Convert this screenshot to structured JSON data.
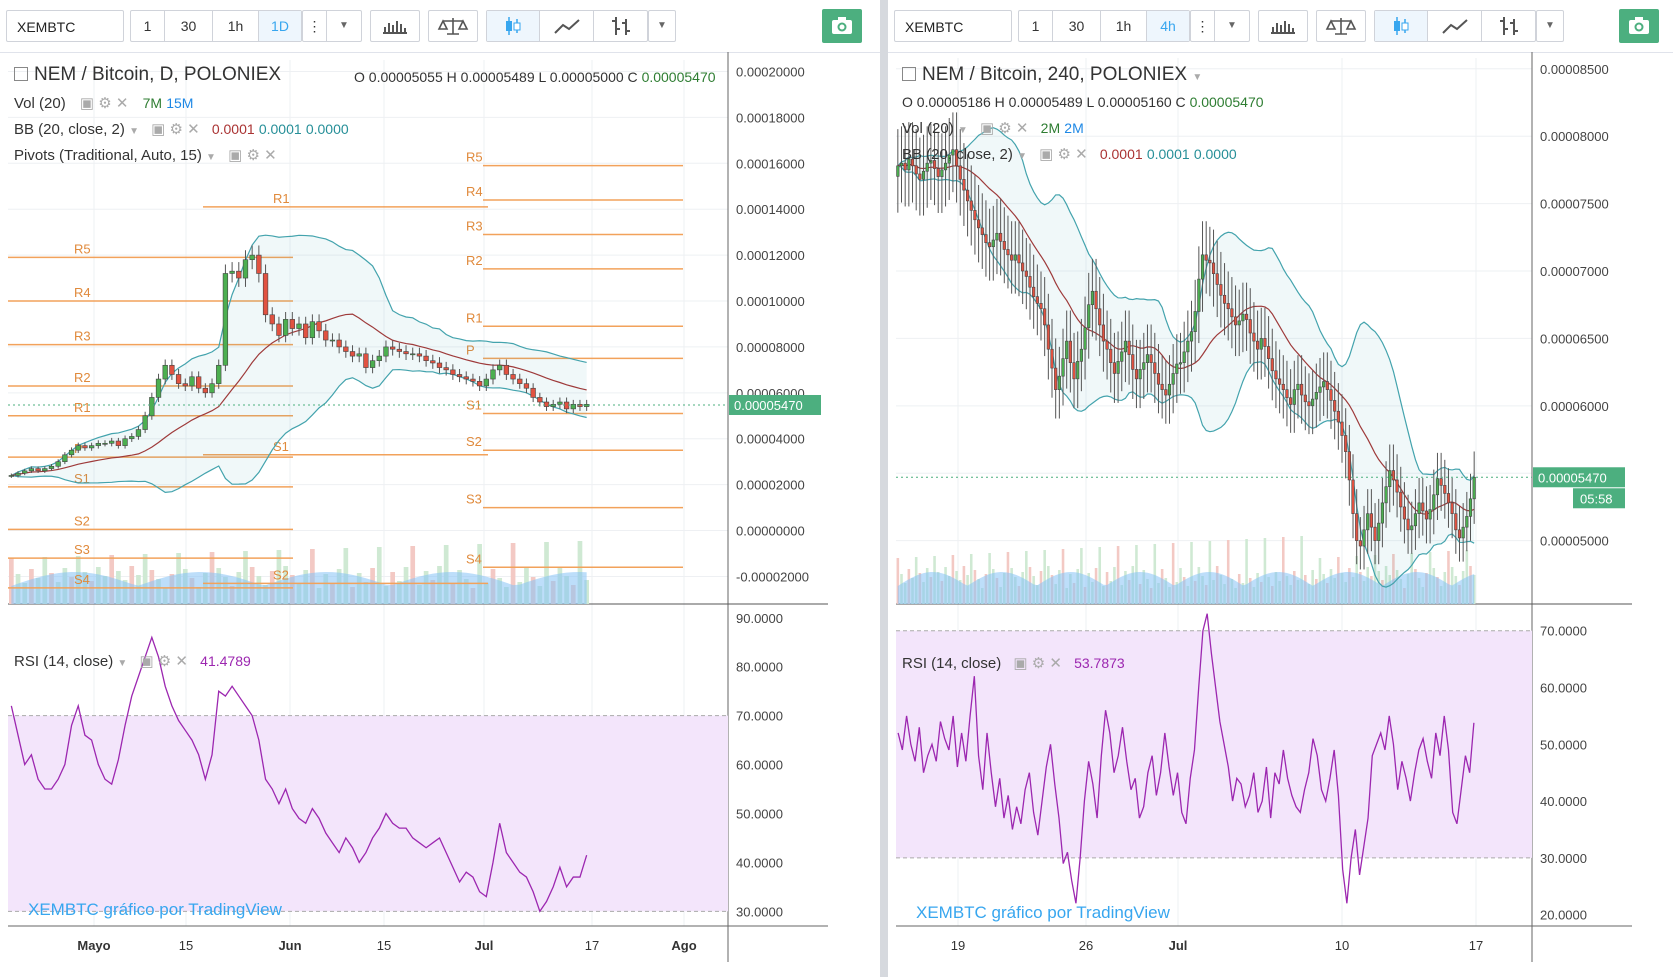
{
  "left": {
    "symbol": "XEMBTC",
    "intervals": [
      "1",
      "30",
      "1h",
      "1D"
    ],
    "active_interval": "1D",
    "title": "NEM / Bitcoin, D, POLONIEX",
    "ohlc": {
      "o_label": "O",
      "o": "0.00005055",
      "h_label": "H",
      "h": "0.00005489",
      "l_label": "L",
      "l": "0.00005000",
      "c_label": "C",
      "c": "0.00005470"
    },
    "vol": {
      "label": "Vol (20)",
      "v1": "7M",
      "v2": "15M"
    },
    "bb": {
      "label": "BB (20, close, 2)",
      "v1": "0.0001",
      "v2": "0.0001",
      "v3": "0.0000"
    },
    "pivots": {
      "label": "Pivots (Traditional, Auto, 15)"
    },
    "rsi": {
      "label": "RSI (14, close)",
      "value": "41.4789"
    },
    "watermark": "XEMBTC gráfico por TradingView",
    "price_tag": "0.00005470",
    "colors": {
      "up": "#4caf50",
      "down": "#e15241",
      "bb": "#43a3ad",
      "basis": "#9e3a3a",
      "pivot": "#f2a25b",
      "rsi": "#9c27b0",
      "rsi_band": "#f3e5fb",
      "tag": "#4caf7f"
    }
  },
  "right": {
    "symbol": "XEMBTC",
    "intervals": [
      "1",
      "30",
      "1h",
      "4h"
    ],
    "active_interval": "4h",
    "title": "NEM / Bitcoin, 240, POLONIEX",
    "ohlc": {
      "o_label": "O",
      "o": "0.00005186",
      "h_label": "H",
      "h": "0.00005489",
      "l_label": "L",
      "l": "0.00005160",
      "c_label": "C",
      "c": "0.00005470"
    },
    "vol": {
      "label": "Vol (20)",
      "v1": "2M",
      "v2": "2M"
    },
    "bb": {
      "label": "BB (20, close, 2)",
      "v1": "0.0001",
      "v2": "0.0001",
      "v3": "0.0000"
    },
    "rsi": {
      "label": "RSI (14, close)",
      "value": "53.7873"
    },
    "watermark": "XEMBTC gráfico por TradingView",
    "price_tag": "0.00005470",
    "countdown": "05:58"
  },
  "chart_data": [
    {
      "type": "candlestick",
      "panel": "left",
      "title": "NEM / Bitcoin, D, POLONIEX",
      "price_axis": [
        "0.00020000",
        "0.00018000",
        "0.00016000",
        "0.00014000",
        "0.00012000",
        "0.00010000",
        "0.00008000",
        "0.00006000",
        "0.00004000",
        "0.00002000",
        "0.00000000",
        "-0.00002000"
      ],
      "ylim": [
        -3.2e-05,
        0.000205
      ],
      "time_axis": [
        "Mayo",
        "15",
        "Jun",
        "15",
        "Jul",
        "17",
        "Ago"
      ],
      "time_axis_bold": [
        "Mayo",
        "Jun",
        "Jul",
        "Ago"
      ],
      "close": [
        2.4e-05,
        2.5e-05,
        2.6e-05,
        2.7e-05,
        2.6e-05,
        2.7e-05,
        2.8e-05,
        3e-05,
        3.3e-05,
        3.5e-05,
        3.7e-05,
        3.6e-05,
        3.7e-05,
        3.8e-05,
        3.8e-05,
        3.9e-05,
        3.7e-05,
        4e-05,
        4.1e-05,
        4.4e-05,
        5e-05,
        5.8e-05,
        6.6e-05,
        7.2e-05,
        6.8e-05,
        6.4e-05,
        6.3e-05,
        6.7e-05,
        6.2e-05,
        6e-05,
        6.4e-05,
        7.2e-05,
        0.000112,
        0.000113,
        0.00011,
        0.000118,
        0.00012,
        0.000112,
        9.4e-05,
        9e-05,
        8.5e-05,
        9.2e-05,
        8.8e-05,
        9e-05,
        8.4e-05,
        9.1e-05,
        8.7e-05,
        8.3e-05,
        8.3e-05,
        8e-05,
        7.8e-05,
        7.6e-05,
        7.7e-05,
        7.1e-05,
        7.4e-05,
        7.6e-05,
        8e-05,
        7.9e-05,
        7.8e-05,
        7.7e-05,
        7.7e-05,
        7.6e-05,
        7.4e-05,
        7.3e-05,
        7.1e-05,
        7e-05,
        6.8e-05,
        6.7e-05,
        6.6e-05,
        6.5e-05,
        6.3e-05,
        6.6e-05,
        7e-05,
        7.2e-05,
        6.8e-05,
        6.6e-05,
        6.4e-05,
        6.2e-05,
        5.8e-05,
        5.6e-05,
        5.4e-05,
        5.5e-05,
        5.6e-05,
        5.3e-05,
        5.5e-05,
        5.4e-05,
        5.5e-05
      ],
      "pivot_levels": [
        {
          "label": "R5",
          "value": 0.000119
        },
        {
          "label": "R4",
          "value": 0.0001
        },
        {
          "label": "R3",
          "value": 8.1e-05
        },
        {
          "label": "R2",
          "value": 6.3e-05
        },
        {
          "label": "R1",
          "value": 5e-05
        },
        {
          "label": "P",
          "value": 3.2e-05
        },
        {
          "label": "S1",
          "value": 1.9e-05
        },
        {
          "label": "S2",
          "value": 5e-07
        },
        {
          "label": "S3",
          "value": -1.2e-05
        },
        {
          "label": "S4",
          "value": -2.5e-05
        },
        {
          "label": "R1",
          "value": 0.000141
        },
        {
          "label": "S1",
          "value": 3.3e-05
        },
        {
          "label": "S2",
          "value": -2.3e-05
        },
        {
          "label": "R5",
          "value": 0.000159
        },
        {
          "label": "R4",
          "value": 0.000144
        },
        {
          "label": "R3",
          "value": 0.000129
        },
        {
          "label": "R2",
          "value": 0.000114
        },
        {
          "label": "R1",
          "value": 8.9e-05
        },
        {
          "label": "P",
          "value": 7.5e-05
        },
        {
          "label": "S1",
          "value": 5.1e-05
        },
        {
          "label": "S2",
          "value": 3.5e-05
        },
        {
          "label": "S3",
          "value": 1e-05
        },
        {
          "label": "S4",
          "value": -1.6e-05
        }
      ],
      "rsi_axis": [
        "90.0000",
        "80.0000",
        "70.0000",
        "60.0000",
        "50.0000",
        "40.0000",
        "30.0000"
      ],
      "rsi_ylim": [
        27,
        92
      ],
      "rsi_band": [
        30,
        70
      ],
      "rsi_values": [
        72,
        66,
        60,
        62,
        57,
        55,
        55,
        57,
        60,
        68,
        72,
        66,
        65,
        60,
        57,
        56,
        61,
        68,
        74,
        78,
        82,
        86,
        82,
        76,
        72,
        69,
        67,
        65,
        62,
        57,
        62,
        75,
        74,
        76,
        74,
        72,
        70,
        65,
        57,
        55,
        52,
        55,
        51,
        49,
        48,
        51,
        49,
        46,
        44,
        42,
        45,
        43,
        40,
        42,
        45,
        47,
        50,
        48,
        47,
        47,
        45,
        44,
        43,
        44,
        45,
        42,
        39,
        36,
        38,
        37,
        34,
        33,
        40,
        48,
        42,
        40,
        38,
        37,
        34,
        30,
        32,
        35,
        39,
        35,
        37,
        37,
        41.48
      ]
    },
    {
      "type": "candlestick",
      "panel": "right",
      "title": "NEM / Bitcoin, 240, POLONIEX",
      "price_axis": [
        "0.00008500",
        "0.00008000",
        "0.00007500",
        "0.00007000",
        "0.00006500",
        "0.00006000",
        "0.00005500",
        "0.00005000"
      ],
      "ylim": [
        4.53e-05,
        8.58e-05
      ],
      "time_axis": [
        "19",
        "26",
        "Jul",
        "10",
        "17"
      ],
      "time_axis_bold": [
        "Jul"
      ],
      "close": [
        7.78e-05,
        7.8e-05,
        7.75e-05,
        7.83e-05,
        7.78e-05,
        7.72e-05,
        7.68e-05,
        7.74e-05,
        7.8e-05,
        7.82e-05,
        7.76e-05,
        7.7e-05,
        7.75e-05,
        7.8e-05,
        7.86e-05,
        7.9e-05,
        7.78e-05,
        7.68e-05,
        7.6e-05,
        7.52e-05,
        7.45e-05,
        7.38e-05,
        7.32e-05,
        7.27e-05,
        7.21e-05,
        7.18e-05,
        7.23e-05,
        7.28e-05,
        7.22e-05,
        7.16e-05,
        7.12e-05,
        7.08e-05,
        7.12e-05,
        7.06e-05,
        7e-05,
        6.96e-05,
        6.88e-05,
        6.81e-05,
        6.76e-05,
        6.72e-05,
        6.6e-05,
        6.42e-05,
        6.28e-05,
        6.12e-05,
        6.22e-05,
        6.35e-05,
        6.48e-05,
        6.32e-05,
        6.2e-05,
        6.33e-05,
        6.42e-05,
        6.58e-05,
        6.75e-05,
        6.85e-05,
        6.72e-05,
        6.6e-05,
        6.48e-05,
        6.42e-05,
        6.32e-05,
        6.24e-05,
        6.33e-05,
        6.4e-05,
        6.48e-05,
        6.38e-05,
        6.27e-05,
        6.2e-05,
        6.27e-05,
        6.32e-05,
        6.38e-05,
        6.32e-05,
        6.24e-05,
        6.16e-05,
        6.12e-05,
        6.08e-05,
        6.16e-05,
        6.24e-05,
        6.31e-05,
        6.32e-05,
        6.4e-05,
        6.48e-05,
        6.55e-05,
        6.7e-05,
        6.94e-05,
        7.12e-05,
        7.08e-05,
        7.06e-05,
        6.98e-05,
        6.9e-05,
        6.82e-05,
        6.76e-05,
        6.72e-05,
        6.66e-05,
        6.6e-05,
        6.63e-05,
        6.68e-05,
        6.64e-05,
        6.54e-05,
        6.48e-05,
        6.42e-05,
        6.5e-05,
        6.44e-05,
        6.35e-05,
        6.26e-05,
        6.2e-05,
        6.16e-05,
        6.12e-05,
        6.06e-05,
        6.01e-05,
        6.12e-05,
        6.16e-05,
        6.08e-05,
        6.03e-05,
        6e-05,
        6.05e-05,
        6.1e-05,
        6.14e-05,
        6.18e-05,
        6.12e-05,
        6.04e-05,
        5.96e-05,
        5.88e-05,
        5.78e-05,
        5.66e-05,
        5.45e-05,
        5.2e-05,
        5e-05,
        4.96e-05,
        5.08e-05,
        5.2e-05,
        5.1e-05,
        5e-05,
        5.13e-05,
        5.28e-05,
        5.4e-05,
        5.52e-05,
        5.45e-05,
        5.36e-05,
        5.25e-05,
        5.16e-05,
        5.08e-05,
        5.11e-05,
        5.2e-05,
        5.28e-05,
        5.22e-05,
        5.16e-05,
        5.23e-05,
        5.34e-05,
        5.46e-05,
        5.41e-05,
        5.35e-05,
        5.28e-05,
        5.2e-05,
        5.08e-05,
        5.02e-05,
        5.1e-05,
        5.18e-05,
        5.31e-05,
        5.47e-05
      ],
      "rsi_axis": [
        "70.0000",
        "60.0000",
        "50.0000",
        "40.0000",
        "30.0000",
        "20.0000"
      ],
      "rsi_ylim": [
        18,
        74
      ],
      "rsi_band": [
        30,
        70
      ],
      "rsi_values": [
        52,
        49,
        55,
        50,
        47,
        53,
        45,
        48,
        50,
        47,
        54,
        51,
        49,
        55,
        46,
        52,
        47,
        55,
        62,
        48,
        42,
        52,
        45,
        39,
        44,
        37,
        41,
        35,
        39,
        36,
        42,
        45,
        38,
        34,
        40,
        46,
        50,
        43,
        37,
        29,
        31,
        26,
        22,
        30,
        40,
        47,
        43,
        37,
        48,
        56,
        52,
        45,
        48,
        53,
        47,
        42,
        44,
        37,
        39,
        45,
        48,
        41,
        45,
        52,
        46,
        41,
        45,
        38,
        36,
        44,
        49,
        60,
        70,
        73,
        66,
        60,
        54,
        50,
        46,
        40,
        44,
        43,
        39,
        41,
        45,
        38,
        40,
        46,
        37,
        45,
        43,
        49,
        44,
        41,
        39,
        38,
        42,
        45,
        51,
        48,
        42,
        40,
        44,
        49,
        41,
        28,
        22,
        30,
        35,
        27,
        32,
        37,
        48,
        50,
        52,
        49,
        55,
        50,
        42,
        47,
        44,
        40,
        45,
        49,
        51,
        47,
        44,
        52,
        48,
        55,
        49,
        38,
        36,
        42,
        48,
        45,
        53.79
      ]
    }
  ]
}
